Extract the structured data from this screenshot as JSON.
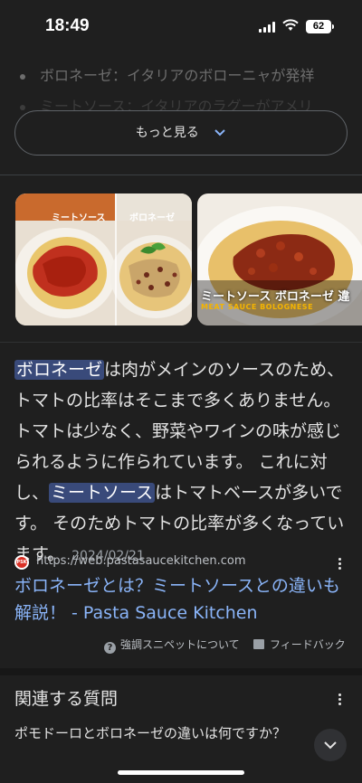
{
  "status_bar": {
    "time": "18:49",
    "battery": "62"
  },
  "bullets": [
    "ボロネーゼ：イタリアのボローニャが発祥",
    "ミートソース：イタリアのラグーがアメリ"
  ],
  "more_button": {
    "label": "もっと見る"
  },
  "images": {
    "left": {
      "label_left": "ミートソース",
      "label_right": "ボロネーゼ"
    },
    "right": {
      "title": "ミートソース ボロネーゼ 違",
      "subtitle": "MEAT SAUCE BOLOGNESE"
    }
  },
  "snippet": {
    "hl1": "ボロネーゼ",
    "text1": "は肉がメインのソースのため、トマトの比率はそこまで多くありません。 トマトは少なく、野菜やワインの味が感じられるように作られています。 これに対し、",
    "hl2": "ミートソース",
    "text2": "はトマトベースが多いです。 そのためトマトの比率が多くなっています。",
    "date": "2024/02/21"
  },
  "source": {
    "favicon_text": "PSK",
    "url": "https://web.pastasaucekitchen.com",
    "title": "ボロネーゼとは？ミートソースとの違いも解説！ - Pasta Sauce Kitchen"
  },
  "feedback": {
    "about_label": "強調スニペットについて",
    "feedback_label": "フィードバック"
  },
  "related": {
    "title": "関連する質問",
    "question": "ポモドーロとボロネーゼの違いは何ですか？"
  },
  "colors": {
    "background": "#1f1f1f",
    "link": "#8ab4f8",
    "highlight": "#394a7a"
  }
}
